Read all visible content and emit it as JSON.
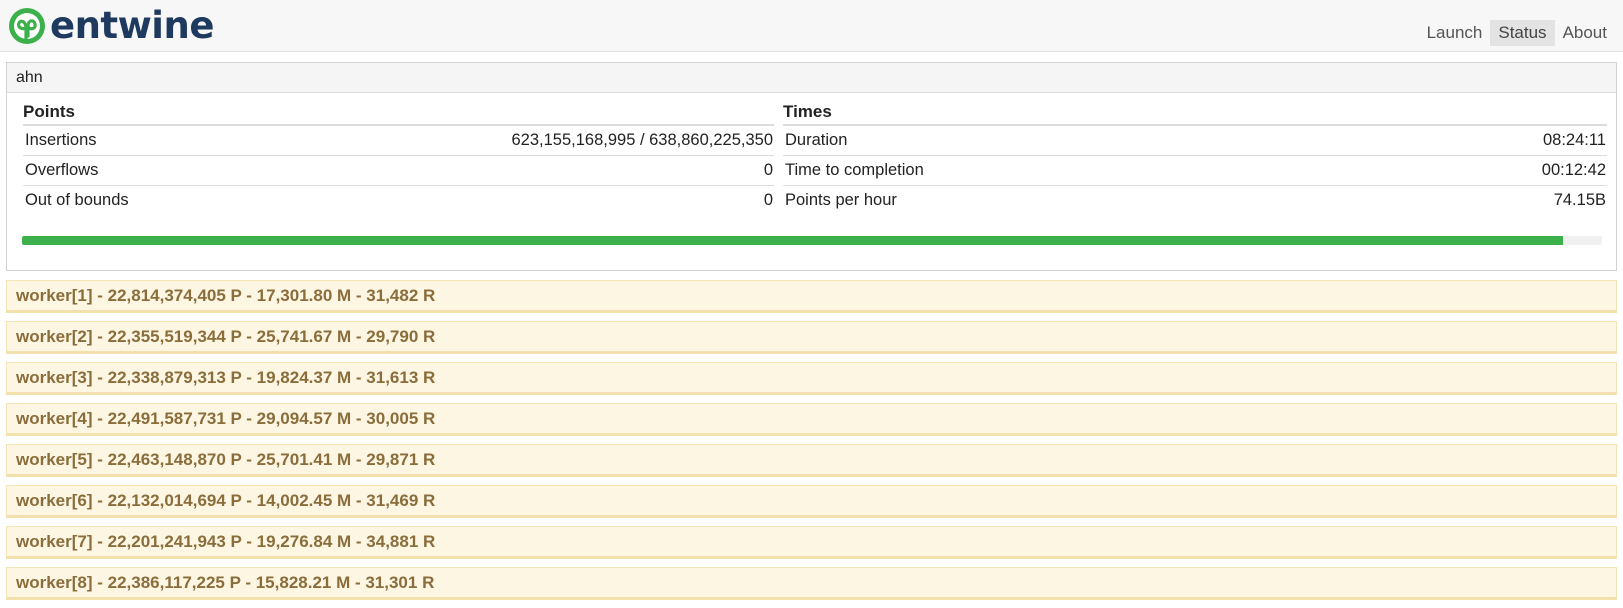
{
  "brand": {
    "name": "entwine"
  },
  "nav": {
    "items": [
      "Launch",
      "Status",
      "About"
    ],
    "active": "Status"
  },
  "job": {
    "name": "ahn",
    "points": {
      "title": "Points",
      "rows": [
        {
          "label": "Insertions",
          "value": "623,155,168,995 / 638,860,225,350"
        },
        {
          "label": "Overflows",
          "value": "0"
        },
        {
          "label": "Out of bounds",
          "value": "0"
        }
      ]
    },
    "times": {
      "title": "Times",
      "rows": [
        {
          "label": "Duration",
          "value": "08:24:11"
        },
        {
          "label": "Time to completion",
          "value": "00:12:42"
        },
        {
          "label": "Points per hour",
          "value": "74.15B"
        }
      ]
    },
    "progress_fraction": 0.975,
    "progress_color": "#3cb04b"
  },
  "workers": [
    "worker[1] - 22,814,374,405 P - 17,301.80 M - 31,482 R",
    "worker[2] - 22,355,519,344 P - 25,741.67 M - 29,790 R",
    "worker[3] - 22,338,879,313 P - 19,824.37 M - 31,613 R",
    "worker[4] - 22,491,587,731 P - 29,094.57 M - 30,005 R",
    "worker[5] - 22,463,148,870 P - 25,701.41 M - 29,871 R",
    "worker[6] - 22,132,014,694 P - 14,002.45 M - 31,469 R",
    "worker[7] - 22,201,241,943 P - 19,276.84 M - 34,881 R",
    "worker[8] - 22,386,117,225 P - 15,828.21 M - 31,301 R"
  ],
  "colors": {
    "brand_green": "#3cb04b",
    "brand_navy": "#1f3a5f",
    "worker_bg": "#fcf6e2",
    "worker_text": "#8a6d3b"
  }
}
